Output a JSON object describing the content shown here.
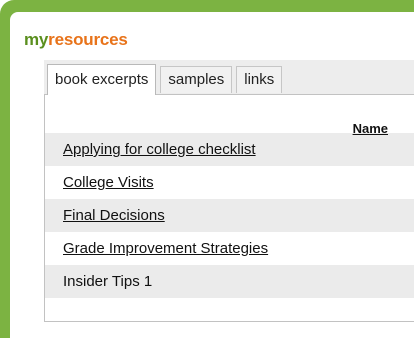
{
  "brand": {
    "prefix": "my",
    "suffix": "resources"
  },
  "tabs": [
    {
      "label": "book excerpts",
      "active": true
    },
    {
      "label": "samples",
      "active": false
    },
    {
      "label": "links",
      "active": false
    }
  ],
  "table": {
    "header": "Name",
    "rows": [
      "Applying for college checklist",
      "College Visits",
      "Final Decisions",
      "Grade Improvement Strategies",
      "Insider Tips 1"
    ]
  },
  "colors": {
    "frame_green": "#7cb342",
    "brand_green": "#5a8f1e",
    "brand_orange": "#e8731a"
  }
}
